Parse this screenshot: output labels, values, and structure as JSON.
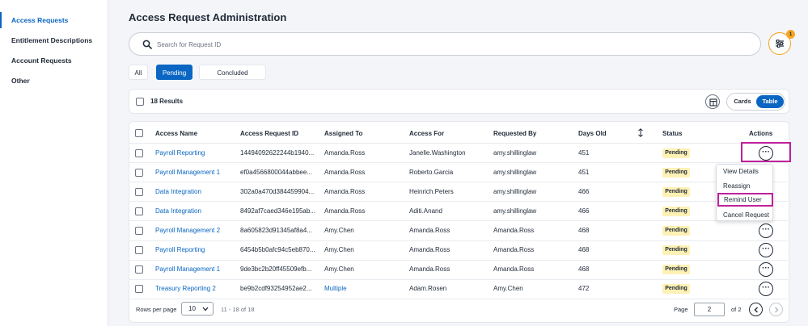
{
  "sidebar": {
    "items": [
      {
        "label": "Access Requests",
        "active": true
      },
      {
        "label": "Entitlement Descriptions",
        "active": false
      },
      {
        "label": "Account Requests",
        "active": false
      },
      {
        "label": "Other",
        "active": false
      }
    ]
  },
  "header": {
    "title": "Access Request Administration"
  },
  "search": {
    "placeholder": "Search for Request ID",
    "value": ""
  },
  "filter": {
    "badge_count": "1",
    "accent": "#f0a020"
  },
  "tabs": [
    {
      "label": "All",
      "active": false
    },
    {
      "label": "Pending",
      "active": true
    },
    {
      "label": "Concluded",
      "active": false
    }
  ],
  "toolbar": {
    "results": "18 Results",
    "view_cards": "Cards",
    "view_table": "Table"
  },
  "table": {
    "columns": [
      "Access Name",
      "Access Request ID",
      "Assigned To",
      "Access For",
      "Requested By",
      "Days Old",
      "Status",
      "Actions"
    ],
    "rows": [
      {
        "name": "Payroll Reporting",
        "id": "14494092622244b1940...",
        "assigned": "Amanda.Ross",
        "for": "Janelle.Washington",
        "by": "amy.shillinglaw",
        "days": "451",
        "status": "Pending"
      },
      {
        "name": "Payroll Management 1",
        "id": "ef0a4566800044abbee...",
        "assigned": "Amanda.Ross",
        "for": "Roberto.Garcia",
        "by": "amy.shillinglaw",
        "days": "451",
        "status": "Pending"
      },
      {
        "name": "Data Integration",
        "id": "302a0a470d384459904...",
        "assigned": "Amanda.Ross",
        "for": "Heinrich.Peters",
        "by": "amy.shillinglaw",
        "days": "466",
        "status": "Pending"
      },
      {
        "name": "Data Integration",
        "id": "8492af7caed346e195ab...",
        "assigned": "Amanda.Ross",
        "for": "Aditi.Anand",
        "by": "amy.shillinglaw",
        "days": "466",
        "status": "Pending"
      },
      {
        "name": "Payroll Management 2",
        "id": "8a605823d91345af8a4...",
        "assigned": "Amy.Chen",
        "for": "Amanda.Ross",
        "by": "Amanda.Ross",
        "days": "468",
        "status": "Pending"
      },
      {
        "name": "Payroll Reporting",
        "id": "6454b5b0afc94c5eb870...",
        "assigned": "Amy.Chen",
        "for": "Amanda.Ross",
        "by": "Amanda.Ross",
        "days": "468",
        "status": "Pending"
      },
      {
        "name": "Payroll Management 1",
        "id": "9de3bc2b20ff45509efb...",
        "assigned": "Amy.Chen",
        "for": "Amanda.Ross",
        "by": "Amanda.Ross",
        "days": "468",
        "status": "Pending"
      },
      {
        "name": "Treasury Reporting 2",
        "id": "be9b2cdf93254952ae2...",
        "assigned": "Multiple",
        "for": "Adam.Rosen",
        "by": "Amy.Chen",
        "days": "472",
        "status": "Pending"
      }
    ]
  },
  "action_menu": {
    "items": [
      "View Details",
      "Reassign",
      "Remind User",
      "Cancel Request"
    ]
  },
  "footer": {
    "rows_per_page_label": "Rows per page",
    "rows_per_page_value": "10",
    "range": "11 - 18 of 18",
    "page_label": "Page",
    "page_value": "2",
    "page_of": "of 2"
  }
}
